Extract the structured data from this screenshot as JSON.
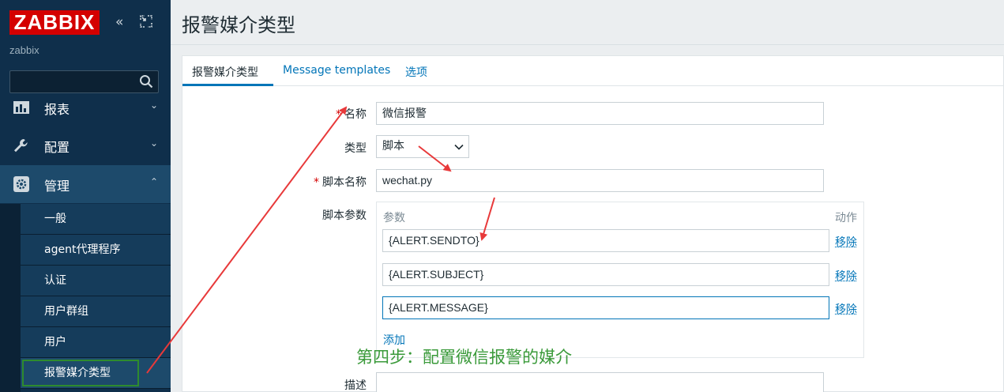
{
  "brand": {
    "logo_text": "ZABBIX",
    "server_name": "zabbix",
    "logo_color": "#d40000"
  },
  "sidebar": {
    "search": {
      "value": ""
    },
    "menu": [
      {
        "label": "报表",
        "icon": "chart-icon"
      },
      {
        "label": "配置",
        "icon": "wrench-icon"
      },
      {
        "label": "管理",
        "icon": "gear-icon"
      }
    ],
    "submenu": [
      "一般",
      "agent代理程序",
      "认证",
      "用户群组",
      "用户",
      "报警媒介类型"
    ]
  },
  "page": {
    "title": "报警媒介类型"
  },
  "tabs": [
    {
      "label": "报警媒介类型",
      "active": true
    },
    {
      "label": "Message templates",
      "active": false
    },
    {
      "label": "选项",
      "active": false
    }
  ],
  "form": {
    "name_label": "名称",
    "name_value": "微信报警",
    "type_label": "类型",
    "type_value": "脚本",
    "script_name_label": "脚本名称",
    "script_name_value": "wechat.py",
    "params_label": "脚本参数",
    "params_col_header": "参数",
    "action_col_header": "动作",
    "params": [
      {
        "value": "{ALERT.SENDTO}",
        "remove_label": "移除"
      },
      {
        "value": "{ALERT.SUBJECT}",
        "remove_label": "移除"
      },
      {
        "value": "{ALERT.MESSAGE}",
        "remove_label": "移除"
      }
    ],
    "add_label": "添加",
    "description_label": "描述",
    "required_marker": "*"
  },
  "annotation": {
    "text": "第四步：配置微信报警的媒介",
    "color": "#3a9a3a",
    "arrow_color": "#e8393a"
  }
}
